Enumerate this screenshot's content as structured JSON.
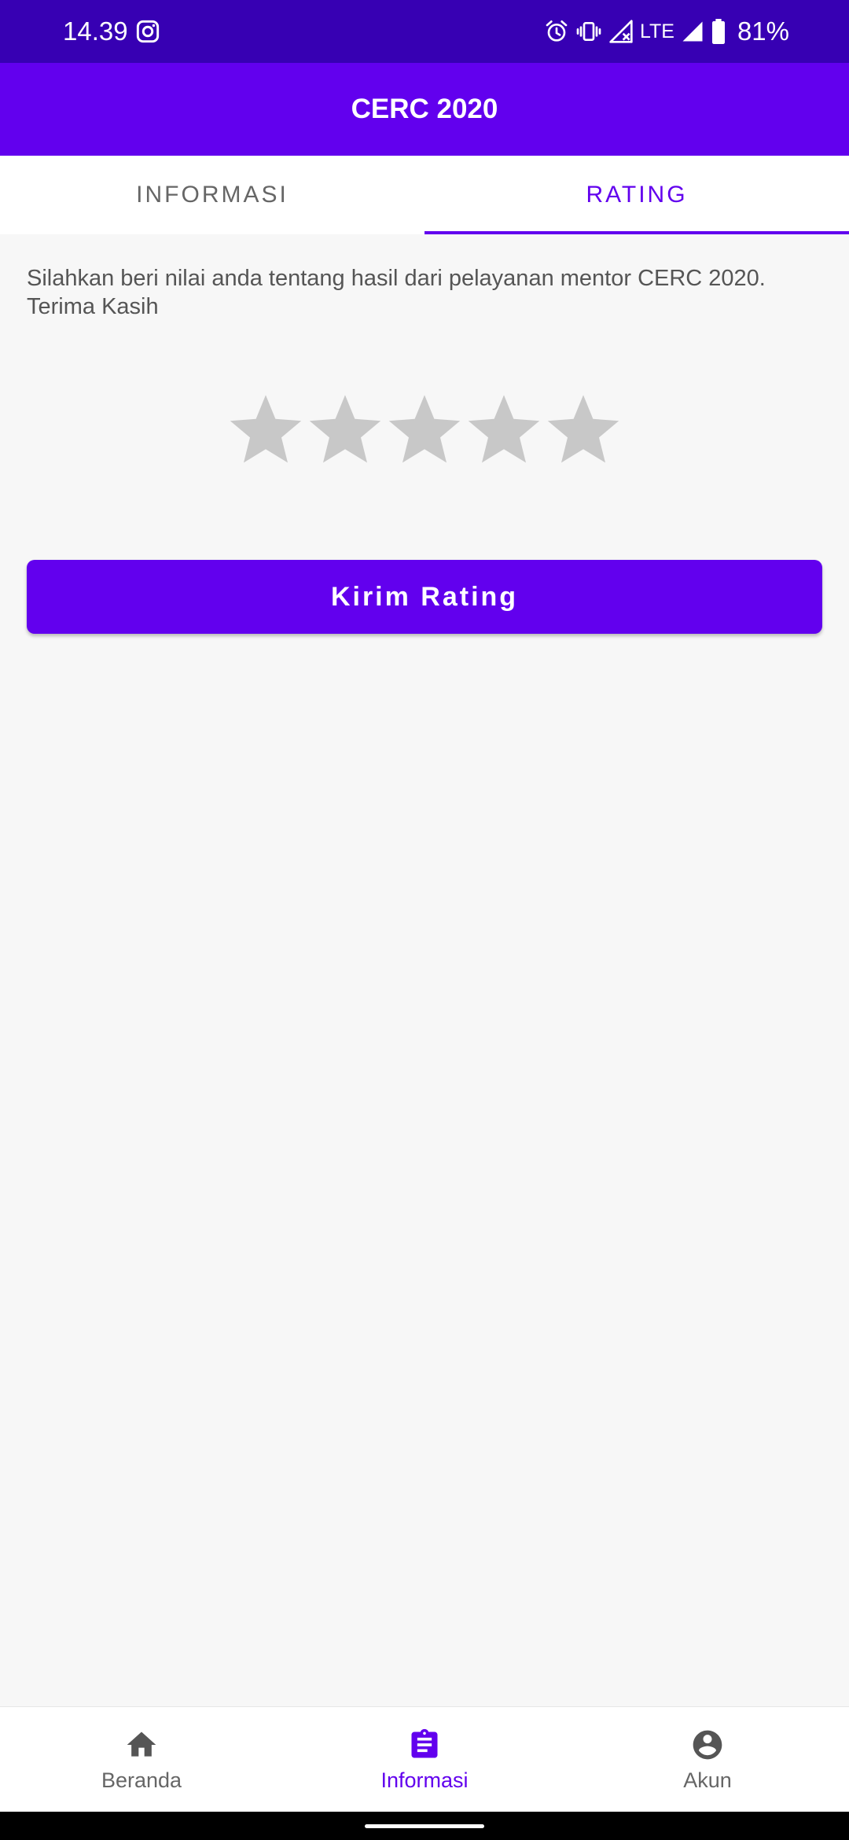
{
  "status_bar": {
    "time": "14.39",
    "network": "LTE",
    "battery": "81%"
  },
  "app_bar": {
    "title": "CERC 2020"
  },
  "tabs": [
    {
      "label": "INFORMASI",
      "active": false
    },
    {
      "label": "RATING",
      "active": true
    }
  ],
  "rating": {
    "instruction": "Silahkan beri nilai anda tentang hasil dari pelayanan mentor CERC 2020. Terima Kasih",
    "max_stars": 5,
    "selected_stars": 0,
    "submit_label": "Kirim Rating"
  },
  "bottom_nav": {
    "items": [
      {
        "label": "Beranda",
        "icon": "home-icon",
        "active": false
      },
      {
        "label": "Informasi",
        "icon": "assignment-icon",
        "active": true
      },
      {
        "label": "Akun",
        "icon": "account-circle-icon",
        "active": false
      }
    ]
  },
  "colors": {
    "status_bar": "#3700b3",
    "primary": "#6200ee",
    "star_empty": "#c8c8c8",
    "inactive": "#666666",
    "background": "#f7f7f7"
  }
}
